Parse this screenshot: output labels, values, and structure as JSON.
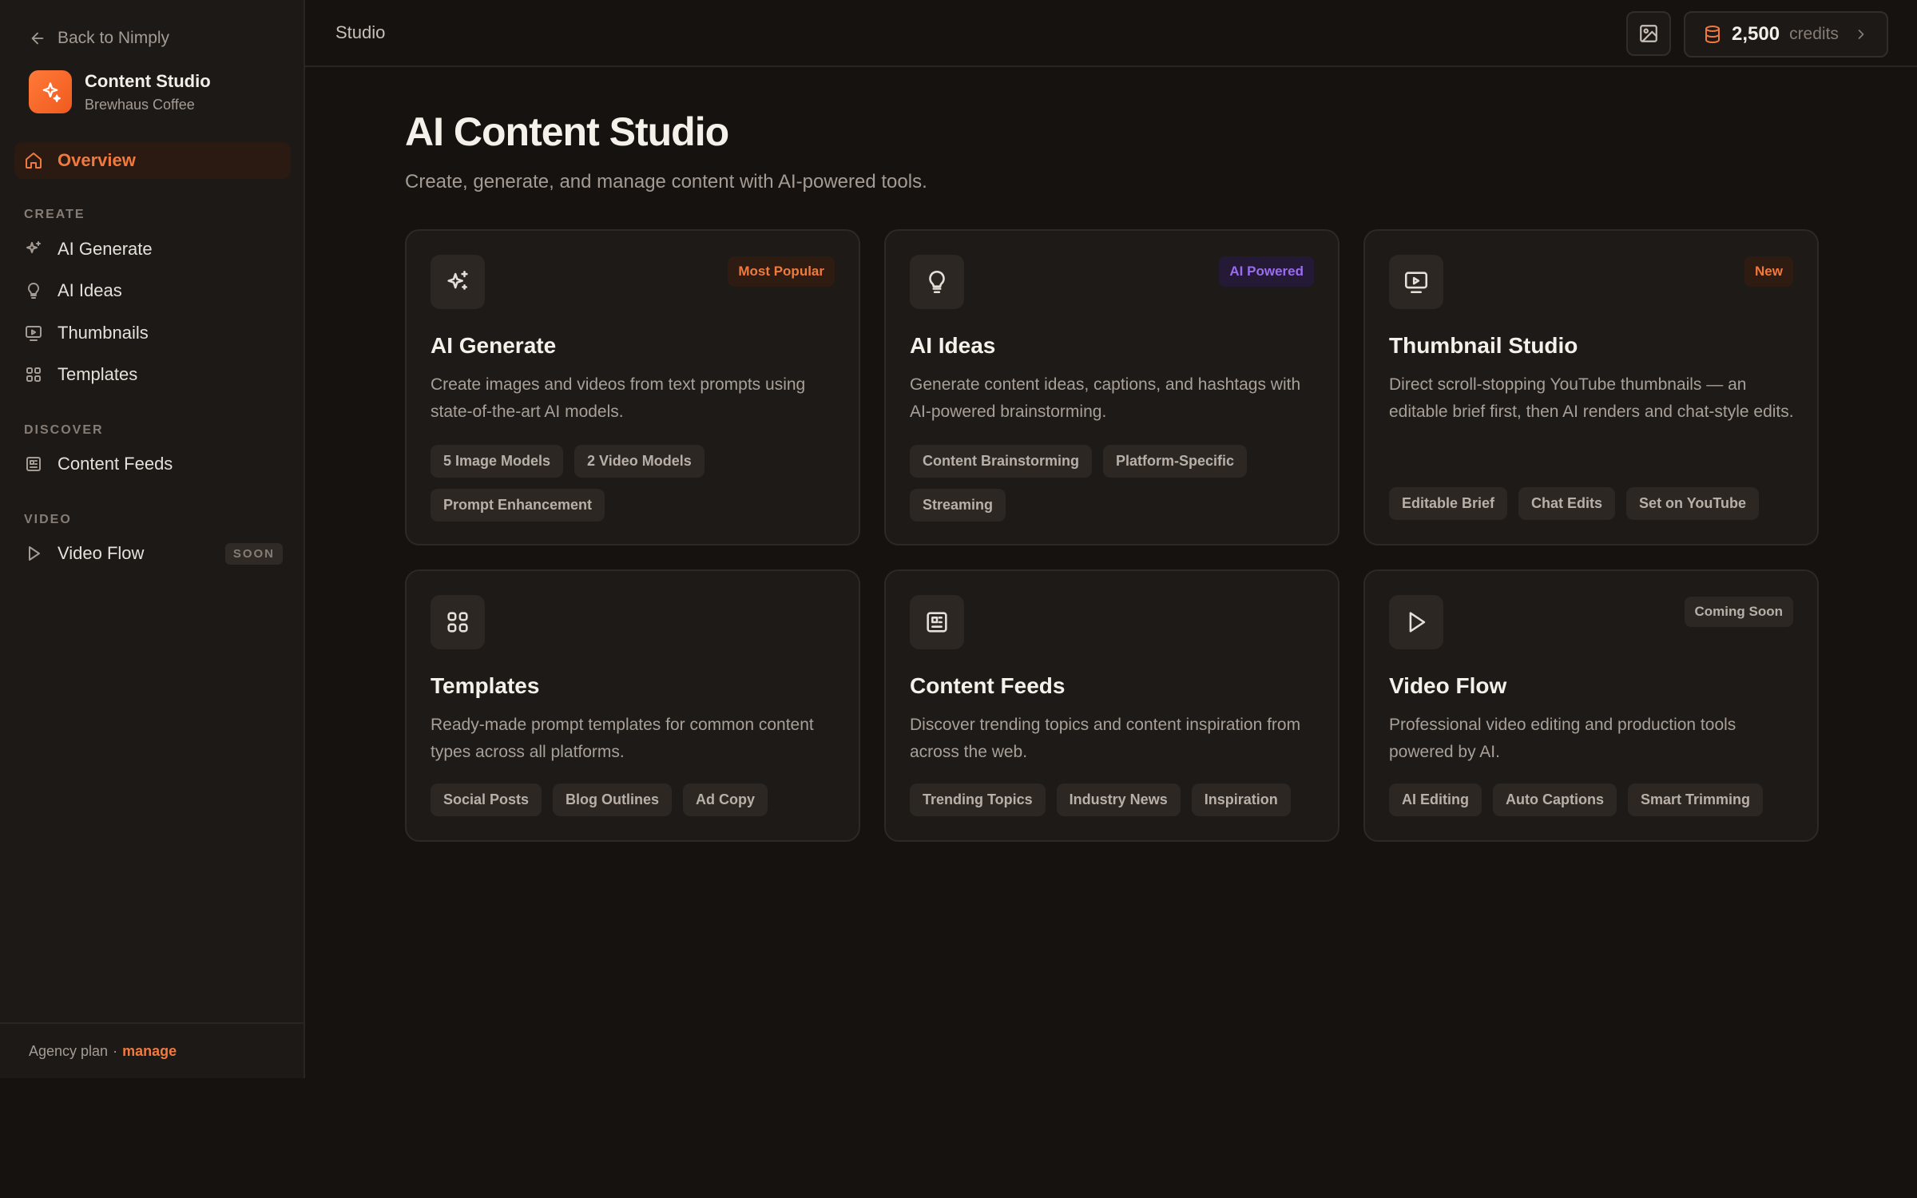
{
  "sidebar": {
    "back_label": "Back to Nimply",
    "brand_name": "Content Studio",
    "brand_sub": "Brewhaus Coffee",
    "overview_label": "Overview",
    "sections": {
      "create": "CREATE",
      "discover": "DISCOVER",
      "video": "VIDEO"
    },
    "items": {
      "ai_generate": "AI Generate",
      "ai_ideas": "AI Ideas",
      "thumbnails": "Thumbnails",
      "templates": "Templates",
      "content_feeds": "Content Feeds",
      "video_flow": "Video Flow",
      "soon_badge": "SOON"
    },
    "footer": {
      "plan": "Agency plan",
      "separator": "·",
      "manage": "manage"
    }
  },
  "topbar": {
    "title": "Studio",
    "credits_value": "2,500",
    "credits_label": "credits"
  },
  "main": {
    "title": "AI Content Studio",
    "subtitle": "Create, generate, and manage content with AI-powered tools.",
    "cards": [
      {
        "title": "AI Generate",
        "badge": "Most Popular",
        "description": "Create images and videos from text prompts using state-of-the-art AI models.",
        "tags": [
          "5 Image Models",
          "2 Video Models",
          "Prompt Enhancement"
        ]
      },
      {
        "title": "AI Ideas",
        "badge": "AI Powered",
        "description": "Generate content ideas, captions, and hashtags with AI-powered brainstorming.",
        "tags": [
          "Content Brainstorming",
          "Platform-Specific",
          "Streaming"
        ]
      },
      {
        "title": "Thumbnail Studio",
        "badge": "New",
        "description": "Direct scroll-stopping YouTube thumbnails — an editable brief first, then AI renders and chat-style edits.",
        "tags": [
          "Editable Brief",
          "Chat Edits",
          "Set on YouTube"
        ]
      },
      {
        "title": "Templates",
        "description": "Ready-made prompt templates for common content types across all platforms.",
        "tags": [
          "Social Posts",
          "Blog Outlines",
          "Ad Copy"
        ]
      },
      {
        "title": "Content Feeds",
        "description": "Discover trending topics and content inspiration from across the web.",
        "tags": [
          "Trending Topics",
          "Industry News",
          "Inspiration"
        ]
      },
      {
        "title": "Video Flow",
        "badge": "Coming Soon",
        "description": "Professional video editing and production tools powered by AI.",
        "tags": [
          "AI Editing",
          "Auto Captions",
          "Smart Trimming"
        ]
      }
    ]
  },
  "colors": {
    "accent": "#f07a3e",
    "background": "#16120f",
    "sidebar": "#1d1916",
    "card": "#1e1a17",
    "badge_popular": "#f07a3e",
    "badge_ai": "#9b6cf0"
  },
  "icons": {
    "back": "arrow-left-icon",
    "brand": "sparkles-icon",
    "overview": "home-icon",
    "ai_generate": "sparkles-icon",
    "ai_ideas": "lightbulb-icon",
    "thumbnails": "monitor-play-icon",
    "templates": "grid-icon",
    "content_feeds": "newspaper-icon",
    "video_flow": "play-icon",
    "image": "image-icon",
    "credits": "database-icon"
  }
}
